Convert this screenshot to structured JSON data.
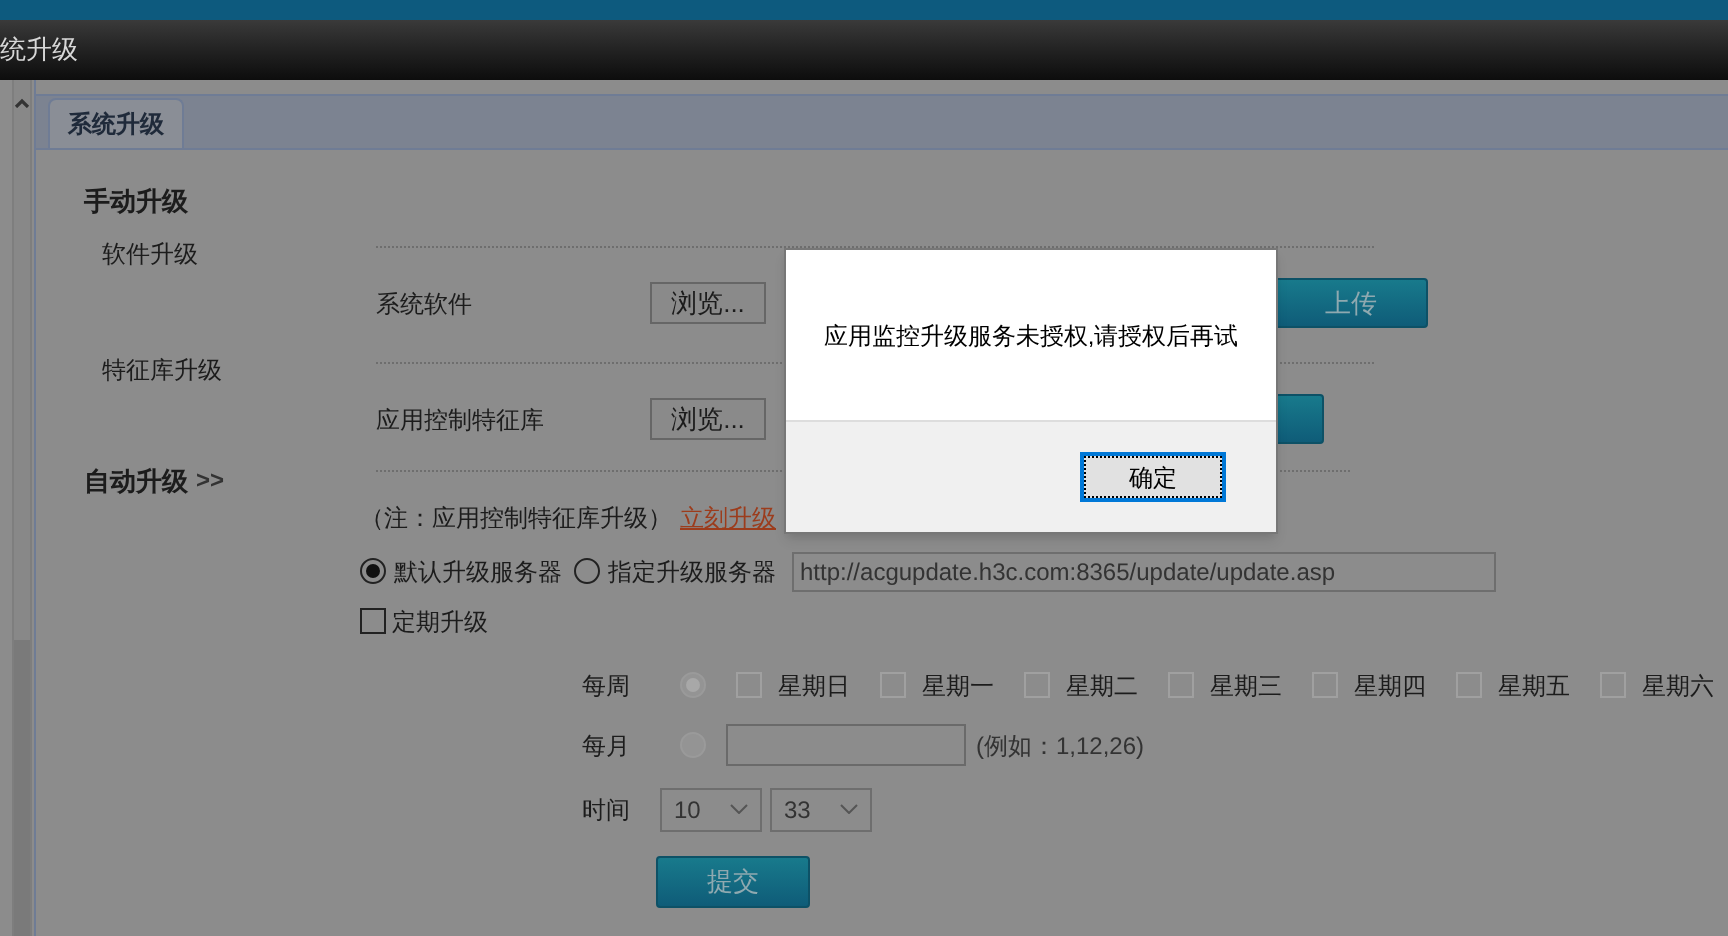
{
  "window": {
    "title": "统升级"
  },
  "tabs": [
    {
      "label": "系统升级",
      "selected": true
    }
  ],
  "manual": {
    "heading": "手动升级",
    "sections": [
      {
        "title": "软件升级",
        "label": "系统软件",
        "browse": "浏览...",
        "upload": "上传"
      },
      {
        "title": "特征库升级",
        "label": "应用控制特征库",
        "browse": "浏览..."
      }
    ]
  },
  "auto": {
    "heading": "自动升级",
    "toggle": ">>",
    "note": "（注：应用控制特征库升级）",
    "link": "立刻升级",
    "servers": [
      {
        "label": "默认升级服务器",
        "selected": true
      },
      {
        "label": "指定升级服务器",
        "selected": false
      }
    ],
    "server_url": "http://acgupdate.h3c.com:8365/update/update.asp",
    "scheduled": {
      "label": "定期升级",
      "checked": false
    },
    "weekly": {
      "label": "每周",
      "selected": true,
      "disabled": true,
      "days": [
        {
          "label": "星期日",
          "checked": false
        },
        {
          "label": "星期一",
          "checked": false
        },
        {
          "label": "星期二",
          "checked": false
        },
        {
          "label": "星期三",
          "checked": false
        },
        {
          "label": "星期四",
          "checked": false
        },
        {
          "label": "星期五",
          "checked": false
        },
        {
          "label": "星期六",
          "checked": false
        }
      ]
    },
    "monthly": {
      "label": "每月",
      "selected": false,
      "disabled": true,
      "hint": "(例如：1,12,26)"
    },
    "time": {
      "label": "时间",
      "hour": "10",
      "minute": "33"
    },
    "submit": "提交"
  },
  "dialog": {
    "message": "应用监控升级服务未授权,请授权后再试",
    "button": "确定"
  }
}
